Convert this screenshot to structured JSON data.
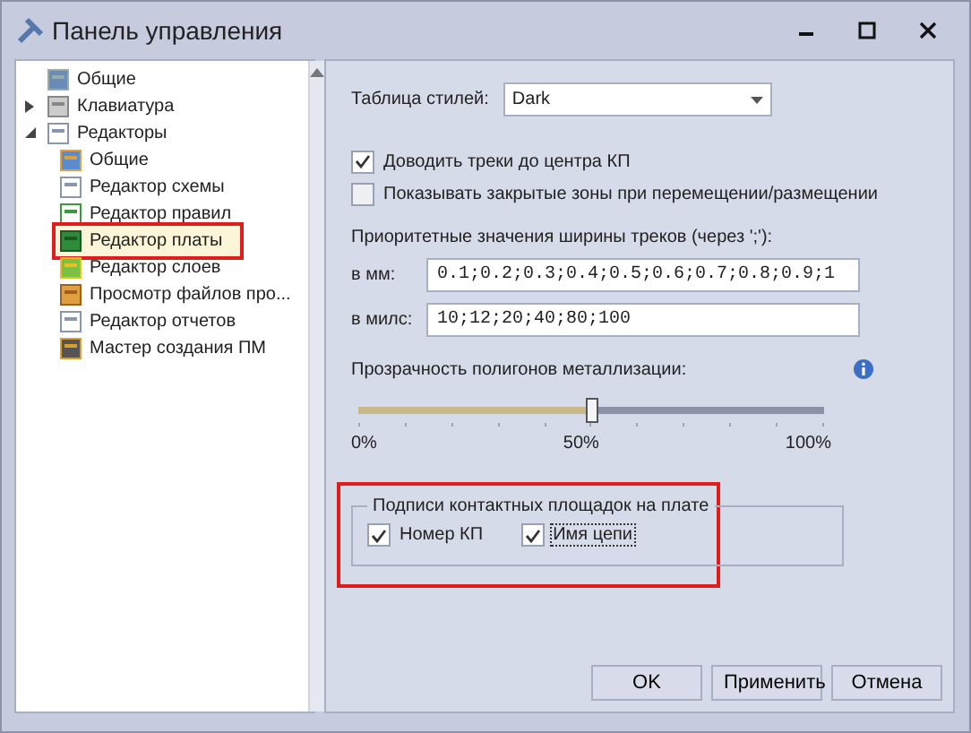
{
  "window": {
    "title": "Панель управления"
  },
  "tree": [
    {
      "label": "Общие",
      "selected": false,
      "annotated": false
    },
    {
      "label": "Клавиатура",
      "expanded": false,
      "selected": false,
      "annotated": false
    },
    {
      "label": "Редакторы",
      "expanded": true,
      "selected": false,
      "annotated": false,
      "children": [
        {
          "label": "Общие",
          "selected": false,
          "annotated": false
        },
        {
          "label": "Редактор схемы",
          "selected": false,
          "annotated": false
        },
        {
          "label": "Редактор правил",
          "selected": false,
          "annotated": false
        },
        {
          "label": "Редактор платы",
          "selected": true,
          "annotated": true
        },
        {
          "label": "Редактор слоев",
          "selected": false,
          "annotated": false
        },
        {
          "label": "Просмотр файлов про...",
          "selected": false,
          "annotated": false
        },
        {
          "label": "Редактор отчетов",
          "selected": false,
          "annotated": false
        },
        {
          "label": "Мастер создания ПМ",
          "selected": false,
          "annotated": false
        }
      ]
    }
  ],
  "style_table": {
    "label": "Таблица стилей:",
    "value": "Dark"
  },
  "options": [
    {
      "label": "Доводить треки до центра КП",
      "checked": true
    },
    {
      "label": "Показывать закрытые зоны при перемещении/размещении",
      "checked": false
    }
  ],
  "widths": {
    "label": "Приоритетные значения ширины треков (через ';'):",
    "fields": [
      {
        "label": "в мм:",
        "value": "0.1;0.2;0.3;0.4;0.5;0.6;0.7;0.8;0.9;1"
      },
      {
        "label": "в милс:",
        "value": "10;12;20;40;80;100"
      }
    ]
  },
  "transparency": {
    "label": "Прозрачность полигонов металлизации:",
    "level": 0.5,
    "ticks": [
      "0%",
      "50%",
      "100%"
    ]
  },
  "pad_labels": {
    "title": "Подписи контактных площадок на плате",
    "annotated": true,
    "options": [
      {
        "label": "Номер КП",
        "checked": true,
        "focused": false
      },
      {
        "label": "Имя цепи",
        "checked": true,
        "focused": true
      }
    ]
  },
  "buttons": [
    "OK",
    "Применить",
    "Отмена"
  ]
}
